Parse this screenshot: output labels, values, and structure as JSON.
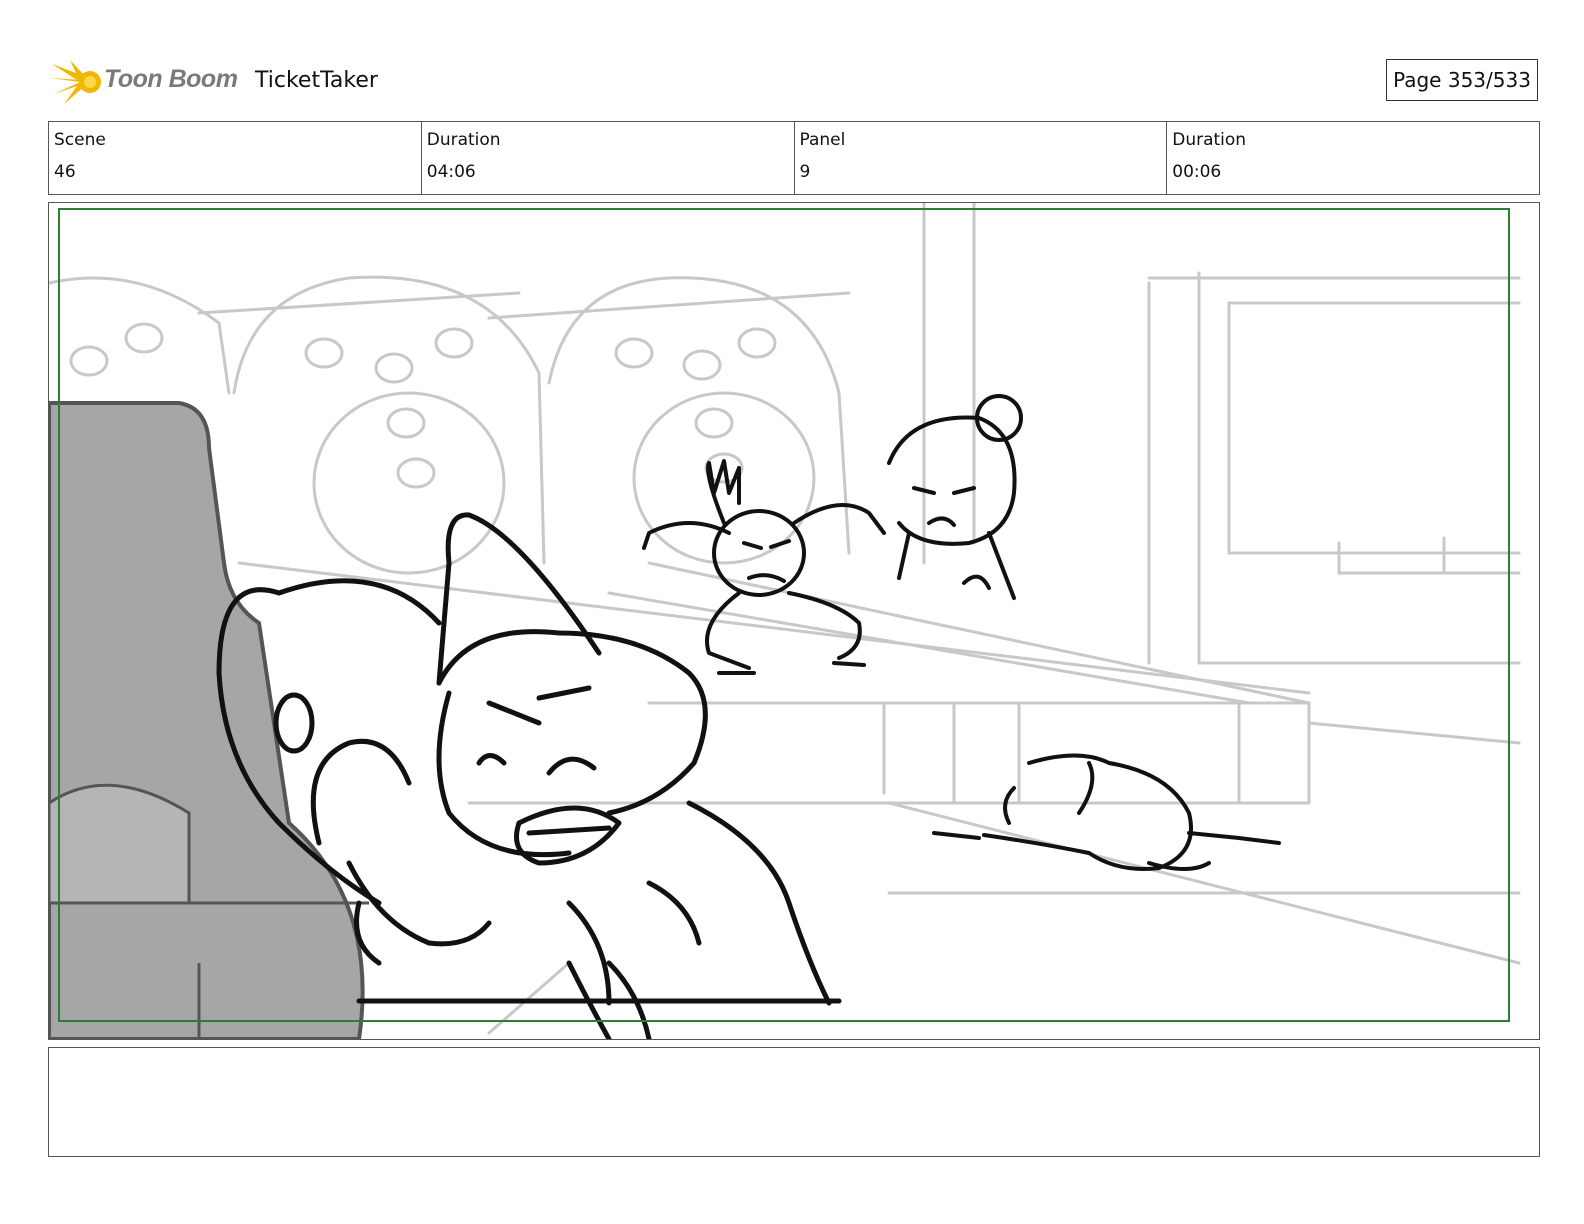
{
  "header": {
    "brand": "Toon Boom",
    "project_title": "TicketTaker",
    "page_indicator": "Page 353/533",
    "logo_icon": "starburst-icon",
    "brand_color": "#f2b705"
  },
  "info": [
    {
      "label": "Scene",
      "value": "46"
    },
    {
      "label": "Duration",
      "value": "04:06"
    },
    {
      "label": "Panel",
      "value": "9"
    },
    {
      "label": "Duration",
      "value": "00:06"
    }
  ],
  "panel": {
    "safe_frame_color": "#2e7d32"
  },
  "notes": {
    "text": ""
  }
}
